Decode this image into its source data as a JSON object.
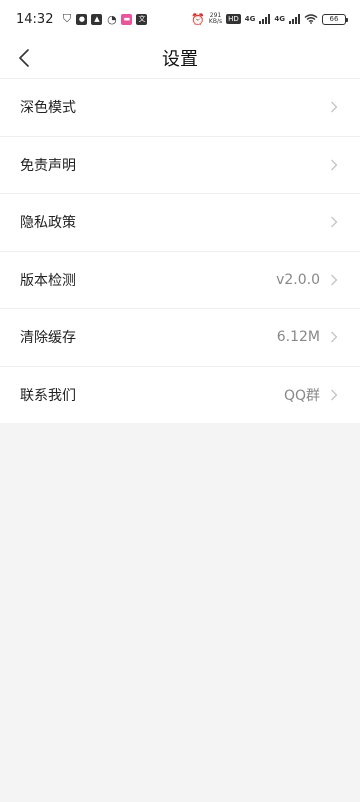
{
  "status_bar": {
    "time": "14:32",
    "net_speed": "291",
    "net_speed_unit": "KB/s",
    "hd_badge": "HD",
    "network_1": "4G",
    "network_2": "4G",
    "battery": "66",
    "left_icons": [
      "shield-icon",
      "chat-icon",
      "image-icon",
      "weibo-icon",
      "app-icon",
      "translate-icon"
    ]
  },
  "navbar": {
    "title": "设置"
  },
  "settings": {
    "items": [
      {
        "label": "深色模式",
        "value": ""
      },
      {
        "label": "免责声明",
        "value": ""
      },
      {
        "label": "隐私政策",
        "value": ""
      },
      {
        "label": "版本检测",
        "value": "v2.0.0"
      },
      {
        "label": "清除缓存",
        "value": "6.12M"
      },
      {
        "label": "联系我们",
        "value": "QQ群"
      }
    ]
  }
}
